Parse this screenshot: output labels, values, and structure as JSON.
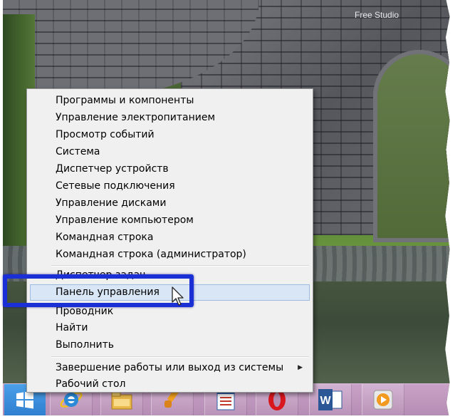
{
  "wallpaper": {
    "label": "Free Studio"
  },
  "context_menu": {
    "groups": [
      [
        "Программы и компоненты",
        "Управление электропитанием",
        "Просмотр событий",
        "Система",
        "Диспетчер устройств",
        "Сетевые подключения",
        "Управление дисками",
        "Управление компьютером",
        "Командная строка",
        "Командная строка (администратор)"
      ],
      [
        "Диспетчер задач",
        "Панель управления",
        "Проводник",
        "Найти",
        "Выполнить"
      ],
      [
        "Завершение работы или выход из системы",
        "Рабочий стол"
      ]
    ],
    "highlighted_item": "Панель управления"
  },
  "colors": {
    "annotation": "#1a2fd6",
    "highlight": "#d8e6f5",
    "taskbar": "#b58db4",
    "start": "#2f7fd0"
  },
  "taskbar": {
    "icons": [
      "windows-start-icon",
      "internet-explorer-icon",
      "file-explorer-icon",
      "paint-icon",
      "document-icon",
      "opera-icon",
      "word-icon",
      "media-player-icon"
    ]
  }
}
